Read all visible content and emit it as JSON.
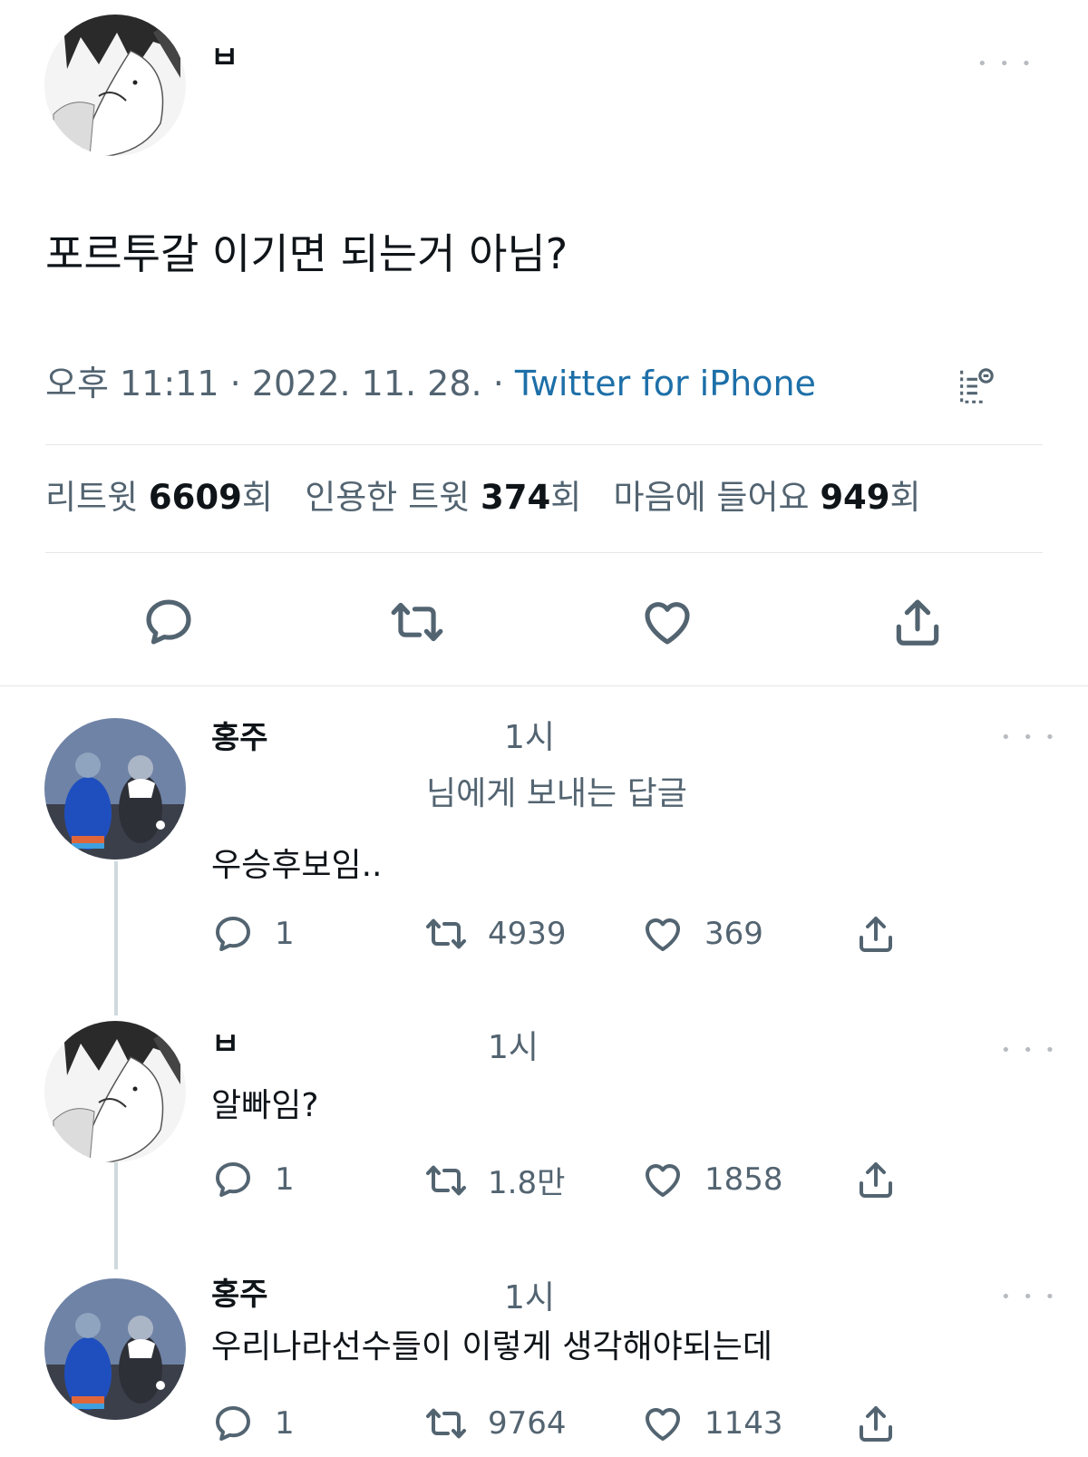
{
  "main_tweet": {
    "author_name": "ㅂ",
    "text": "포르투갈 이기면 되는거 아님?",
    "time": "오후 11:11",
    "date": "2022. 11. 28.",
    "separator": "·",
    "source": "Twitter for iPhone",
    "more": "• • •",
    "stats": {
      "retweets_label": "리트윗",
      "retweets_value": "6609",
      "retweets_unit": "회",
      "quotes_label": "인용한 트윗",
      "quotes_value": "374",
      "quotes_unit": "회",
      "likes_label": "마음에 들어요",
      "likes_value": "949",
      "likes_unit": "회"
    }
  },
  "replies": [
    {
      "author_name": "홍주",
      "time": "1시",
      "replying_to": "님에게 보내는 답글",
      "text": "우승후보임..",
      "replies": "1",
      "retweets": "4939",
      "likes": "369",
      "more": "• • •"
    },
    {
      "author_name": "ㅂ",
      "time": "1시",
      "text": "알빠임?",
      "replies": "1",
      "retweets": "1.8만",
      "likes": "1858",
      "more": "• • •"
    },
    {
      "author_name": "홍주",
      "time": "1시",
      "text": "우리나라선수들이 이렇게 생각해야되는데",
      "replies": "1",
      "retweets": "9764",
      "likes": "1143",
      "more": "• • •"
    }
  ]
}
